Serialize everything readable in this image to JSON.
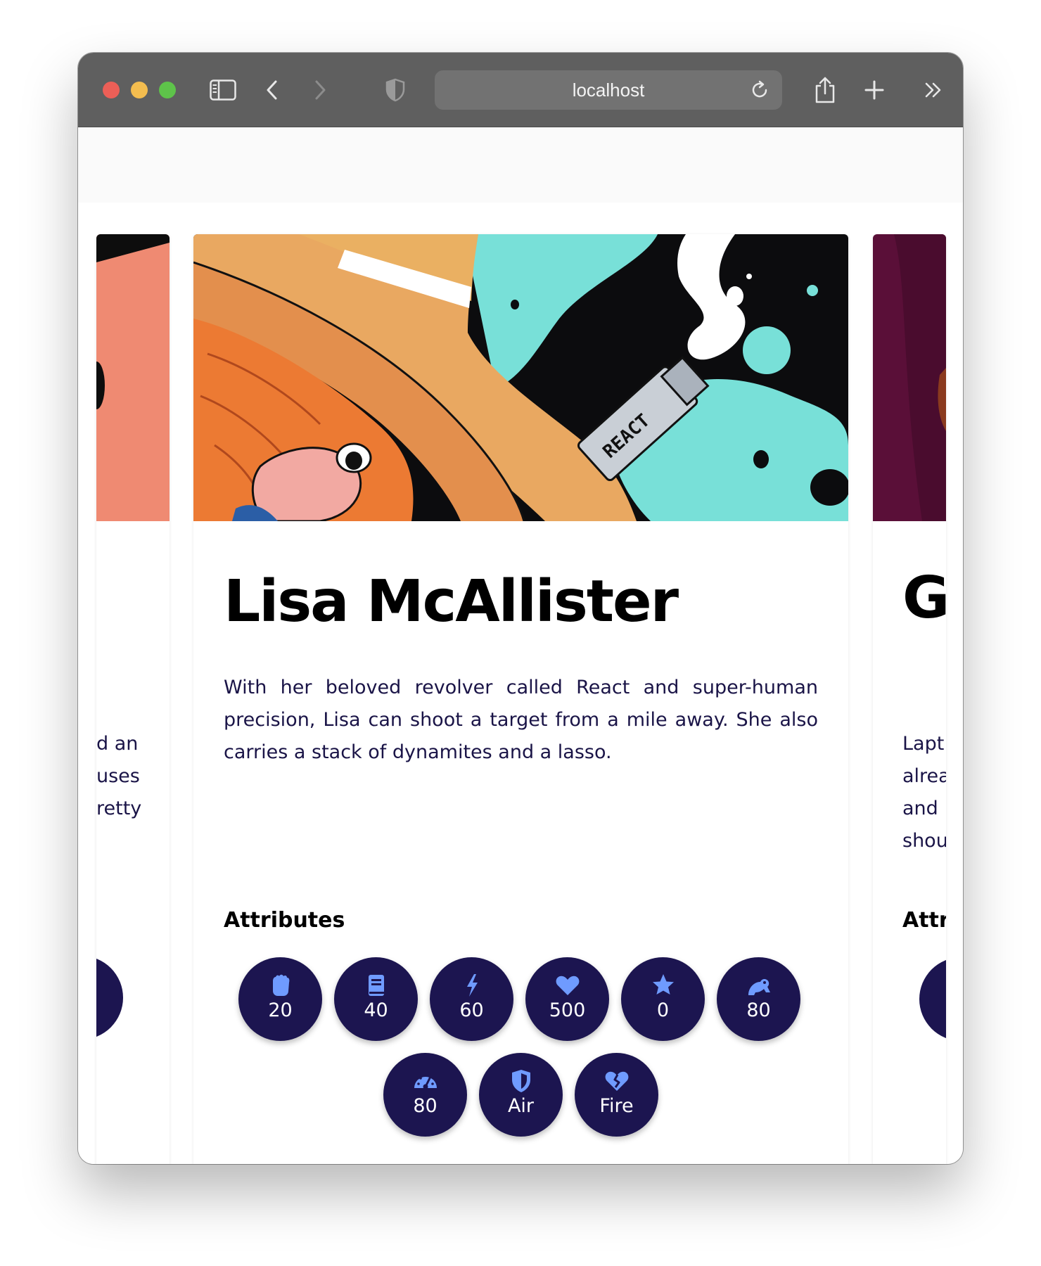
{
  "browser": {
    "url": "localhost",
    "colors": {
      "close": "#ec5f57",
      "minimize": "#f4bd4f",
      "zoom": "#5ec34a"
    },
    "icons": [
      "sidebar-icon",
      "back-icon",
      "forward-icon",
      "shield-icon",
      "reload-icon",
      "share-icon",
      "new-tab-icon",
      "more-icon"
    ]
  },
  "cards": {
    "left": {
      "lines": [
        "d an",
        "uses",
        "retty"
      ]
    },
    "main": {
      "name": "Lisa McAllister",
      "description": "With her beloved revolver called React and super-human precision, Lisa can shoot a target from a mile away. She also carries a stack of dynamites and a lasso.",
      "hero_label": "REACT",
      "attributes_title": "Attributes",
      "attributes": [
        {
          "icon": "fist-icon",
          "value": "20"
        },
        {
          "icon": "book-icon",
          "value": "40"
        },
        {
          "icon": "bolt-icon",
          "value": "60"
        },
        {
          "icon": "heart-icon",
          "value": "500"
        },
        {
          "icon": "star-icon",
          "value": "0"
        },
        {
          "icon": "frog-icon",
          "value": "80"
        },
        {
          "icon": "gauge-icon",
          "value": "80"
        },
        {
          "icon": "shield-icon",
          "value": "Air"
        },
        {
          "icon": "broken-heart-icon",
          "value": "Fire"
        }
      ]
    },
    "right": {
      "name_fragment": "G",
      "lines": [
        "Lapt",
        "alrea",
        "and",
        "shou"
      ],
      "attributes_title_fragment": "Attri"
    }
  },
  "colors": {
    "badge_bg": "#1c1550",
    "badge_icon": "#6f9bff",
    "text_dark_navy": "#1a1447"
  }
}
